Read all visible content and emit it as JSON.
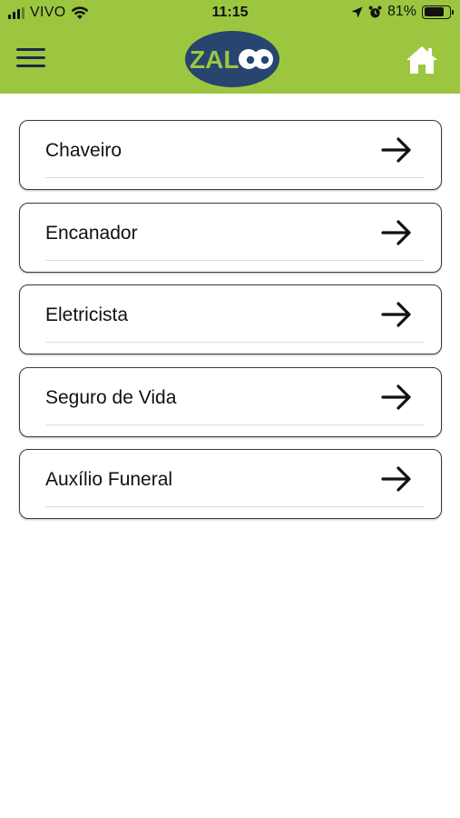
{
  "status_bar": {
    "carrier": "VIVO",
    "time": "11:15",
    "battery_percent": "81%",
    "battery_level": 0.81,
    "icons": [
      "signal-icon",
      "wifi-icon",
      "location-icon",
      "alarm-icon",
      "battery-icon"
    ]
  },
  "header": {
    "background_color": "#9dc640",
    "logo_text": "ZAL",
    "menu_icon": "hamburger-menu-icon",
    "home_icon": "home-icon"
  },
  "services": [
    {
      "label": "Chaveiro"
    },
    {
      "label": "Encanador"
    },
    {
      "label": "Eletricista"
    },
    {
      "label": "Seguro de Vida"
    },
    {
      "label": "Auxílio Funeral"
    }
  ],
  "item_icon": "arrow-right-icon"
}
